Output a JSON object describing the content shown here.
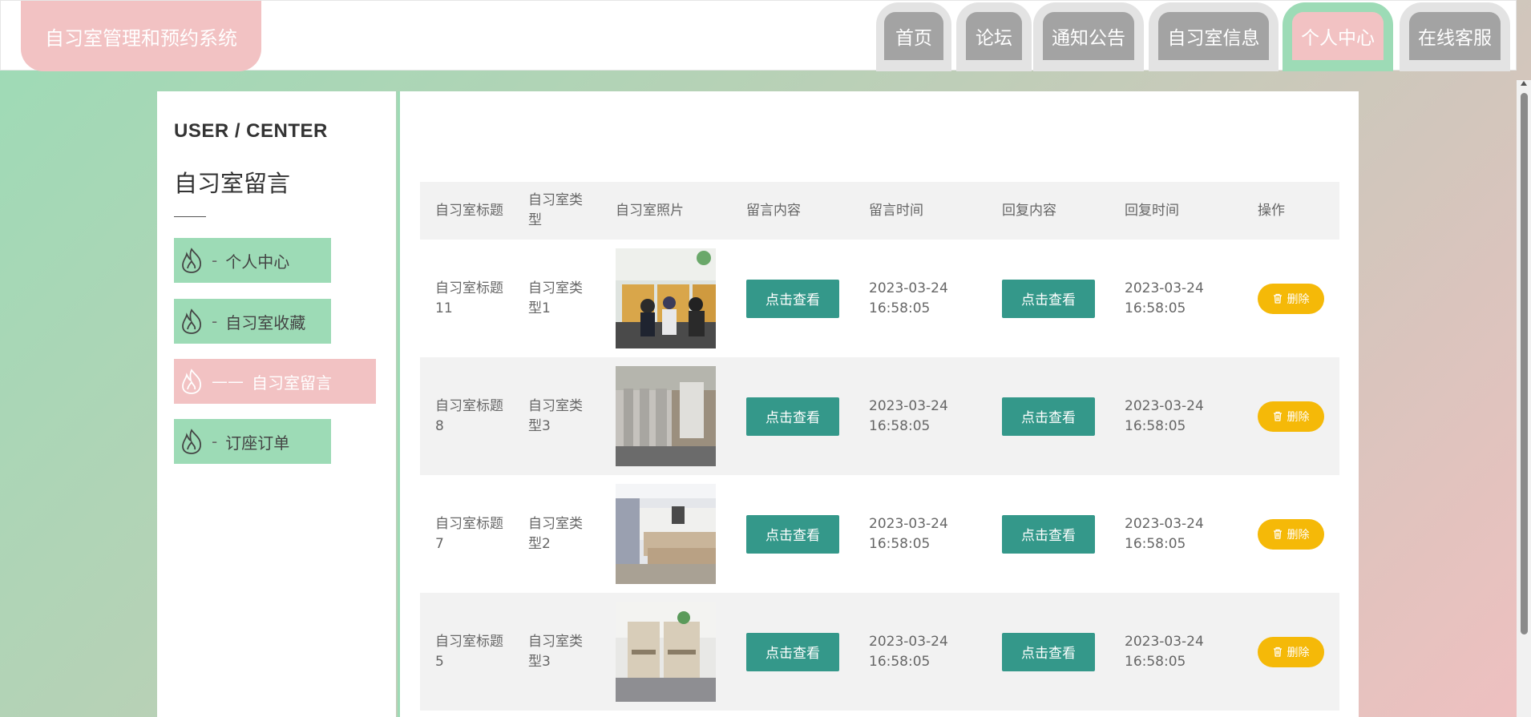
{
  "header": {
    "brand": "自习室管理和预约系统",
    "nav": [
      {
        "label": "首页"
      },
      {
        "label": "论坛"
      },
      {
        "label": "通知公告"
      },
      {
        "label": "自习室信息"
      },
      {
        "label": "个人中心",
        "active": true
      },
      {
        "label": "在线客服"
      }
    ]
  },
  "sidebar": {
    "title": "USER / CENTER",
    "subtitle": "自习室留言",
    "items": [
      {
        "label": "个人中心"
      },
      {
        "label": "自习室收藏"
      },
      {
        "label": "自习室留言",
        "active": true
      },
      {
        "label": "订座订单"
      }
    ]
  },
  "table": {
    "headers": [
      "自习室标题",
      "自习室类型",
      "自习室照片",
      "留言内容",
      "留言时间",
      "回复内容",
      "回复时间",
      "操作"
    ],
    "view_label": "点击查看",
    "delete_label": "删除",
    "rows": [
      {
        "title": "自习室标题11",
        "type": "自习室类型1",
        "photo": "study-room-photo",
        "message_time": "2023-03-24 16:58:05",
        "reply_time": "2023-03-24 16:58:05"
      },
      {
        "title": "自习室标题8",
        "type": "自习室类型3",
        "photo": "study-room-photo",
        "message_time": "2023-03-24 16:58:05",
        "reply_time": "2023-03-24 16:58:05"
      },
      {
        "title": "自习室标题7",
        "type": "自习室类型2",
        "photo": "study-room-photo",
        "message_time": "2023-03-24 16:58:05",
        "reply_time": "2023-03-24 16:58:05"
      },
      {
        "title": "自习室标题5",
        "type": "自习室类型3",
        "photo": "study-room-photo",
        "message_time": "2023-03-24 16:58:05",
        "reply_time": "2023-03-24 16:58:05"
      }
    ]
  },
  "colors": {
    "accent_green": "#9ddbb6",
    "accent_pink": "#f2c2c3",
    "button_teal": "#34988a",
    "delete_yellow": "#f5b908"
  }
}
